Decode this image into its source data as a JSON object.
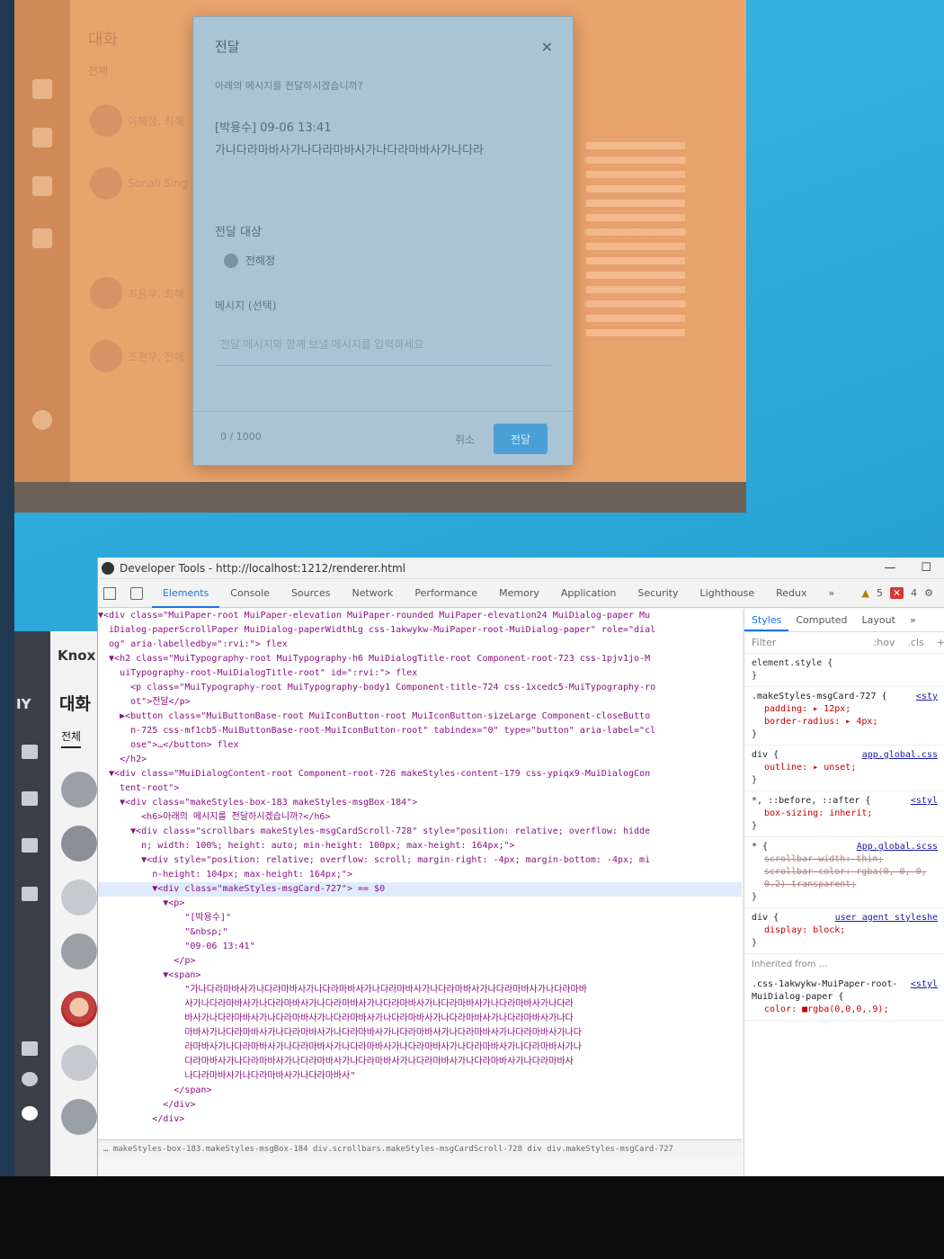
{
  "app": {
    "title": "대화",
    "tabs": "전체",
    "list_names": [
      "이해정, 최해",
      "Sonali Sing",
      "최윤우, 최해",
      "조현우, 전해"
    ]
  },
  "dialog": {
    "title": "전달",
    "subtitle": "아래의 메시지를 전달하시겠습니까?",
    "meta": "[박용수] 09-06 13:41",
    "body": "가나다라마바사가나다라마바사가나다라마바사가나다라",
    "target_label": "전달 대상",
    "target_value": "전해정",
    "message_label": "메시지 (선택)",
    "message_placeholder": "전달 메시지와 함께 보낼 메시지를 입력하세요",
    "count": "0 / 1000",
    "cancel_label": "취소",
    "send_label": "전달"
  },
  "knox": {
    "brand": "Knox",
    "title": "대화",
    "tab": "전체",
    "side_label": "IY"
  },
  "devtools": {
    "window_title": "Developer Tools - http://localhost:1212/renderer.html",
    "tabs": [
      "Elements",
      "Console",
      "Sources",
      "Network",
      "Performance",
      "Memory",
      "Application",
      "Security",
      "Lighthouse",
      "Redux",
      "»"
    ],
    "warn_count": "5",
    "error_count": "4",
    "dom_lines": [
      "▼<div class=\"MuiPaper-root MuiPaper-elevation MuiPaper-rounded MuiPaper-elevation24 MuiDialog-paper Mu",
      "  iDialog-paperScrollPaper MuiDialog-paperWidthLg css-1akwykw-MuiPaper-root-MuiDialog-paper\" role=\"dial",
      "  og\" aria-labelledby=\":rvi:\"> flex",
      "  ▼<h2 class=\"MuiTypography-root MuiTypography-h6 MuiDialogTitle-root Component-root-723 css-1pjv1jo-M",
      "    uiTypography-root-MuiDialogTitle-root\" id=\":rvi:\"> flex",
      "      <p class=\"MuiTypography-root MuiTypography-body1 Component-title-724 css-1xcedc5-MuiTypography-ro",
      "      ot\">전달</p>",
      "    ▶<button class=\"MuiButtonBase-root MuiIconButton-root MuiIconButton-sizeLarge Component-closeButto",
      "      n-725 css-mf1cb5-MuiButtonBase-root-MuiIconButton-root\" tabindex=\"0\" type=\"button\" aria-label=\"cl",
      "      ose\">…</button> flex",
      "    </h2>",
      "  ▼<div class=\"MuiDialogContent-root Component-root-726 makeStyles-content-179 css-ypiqx9-MuiDialogCon",
      "    tent-root\">",
      "    ▼<div class=\"makeStyles-box-183 makeStyles-msgBox-184\">",
      "        <h6>아래의 메시지를 전달하시겠습니까?</h6>",
      "      ▼<div class=\"scrollbars makeStyles-msgCardScroll-728\" style=\"position: relative; overflow: hidde",
      "        n; width: 100%; height: auto; min-height: 100px; max-height: 164px;\">",
      "        ▼<div style=\"position: relative; overflow: scroll; margin-right: -4px; margin-bottom: -4px; mi",
      "          n-height: 104px; max-height: 164px;\">",
      "          ▼<div class=\"makeStyles-msgCard-727\"> == $0",
      "            ▼<p>",
      "                \"[박용수]\"",
      "                \"&nbsp;\"",
      "                \"09-06 13:41\"",
      "              </p>",
      "            ▼<span>",
      "                \"가나다라마바사가나다라마바사가나다라마바사가나다라마바사가나다라마바사가나다라마바사가나다라마바",
      "                사가나다라마바사가나다라마바사가나다라마바사가나다라마바사가나다라마바사가나다라마바사가나다라",
      "                바사가나다라마바사가나다라마바사가나다라마바사가나다라마바사가나다라마바사가나다라마바사가나다",
      "                마바사가나다라마바사가나다라마바사가나다라마바사가나다라마바사가나다라마바사가나다라마바사가나다",
      "                라마바사가나다라마바사가나다라마바사가나다라마바사가나다라마바사가나다라마바사가나다라마바사가나",
      "                다라마바사가나다라마바사가나다라마바사가나다라마바사가나다라마바사가나다라마바사가나다라마바사",
      "                나다라마바사가나다라마바사가나다라마바사\"",
      "              </span>",
      "            </div>",
      "          </div>"
    ],
    "breadcrumb": "… makeStyles-box-183.makeStyles-msgBox-184   div.scrollbars.makeStyles-msgCardScroll-728   div   div.makeStyles-msgCard-727",
    "styles": {
      "tabs": [
        "Styles",
        "Computed",
        "Layout",
        "»"
      ],
      "filter": "Filter",
      "hov": ":hov",
      "cls": ".cls",
      "element_style": "element.style {",
      "rules": [
        {
          "selector": ".makeStyles-msgCard-727 {",
          "source": "<sty",
          "props": [
            "padding: ▸ 12px;",
            "border-radius: ▸ 4px;"
          ],
          "strike": []
        },
        {
          "selector": "div {",
          "source": "app.global.css",
          "props": [
            "outline: ▸ unset;"
          ],
          "strike": []
        },
        {
          "selector": "*, ::before, ::after {",
          "source": "<styl",
          "props": [
            "box-sizing: inherit;"
          ],
          "strike": []
        },
        {
          "selector": "* {",
          "source": "App.global.scss",
          "props": [],
          "strike": [
            "scrollbar-width: thin;",
            "scrollbar-color: rgba(0, 0, 0, 0.2) transparent;"
          ]
        },
        {
          "selector": "div {",
          "source": "user agent styleshe",
          "props": [
            "display: block;"
          ],
          "strike": []
        }
      ],
      "inherited": "Inherited from …",
      "inh_selector": ".css-1akwykw-MuiPaper-root-MuiDialog-paper {",
      "inh_source": "<styl",
      "inh_color": "color: ■rgba(0,0,0,.9);"
    }
  }
}
